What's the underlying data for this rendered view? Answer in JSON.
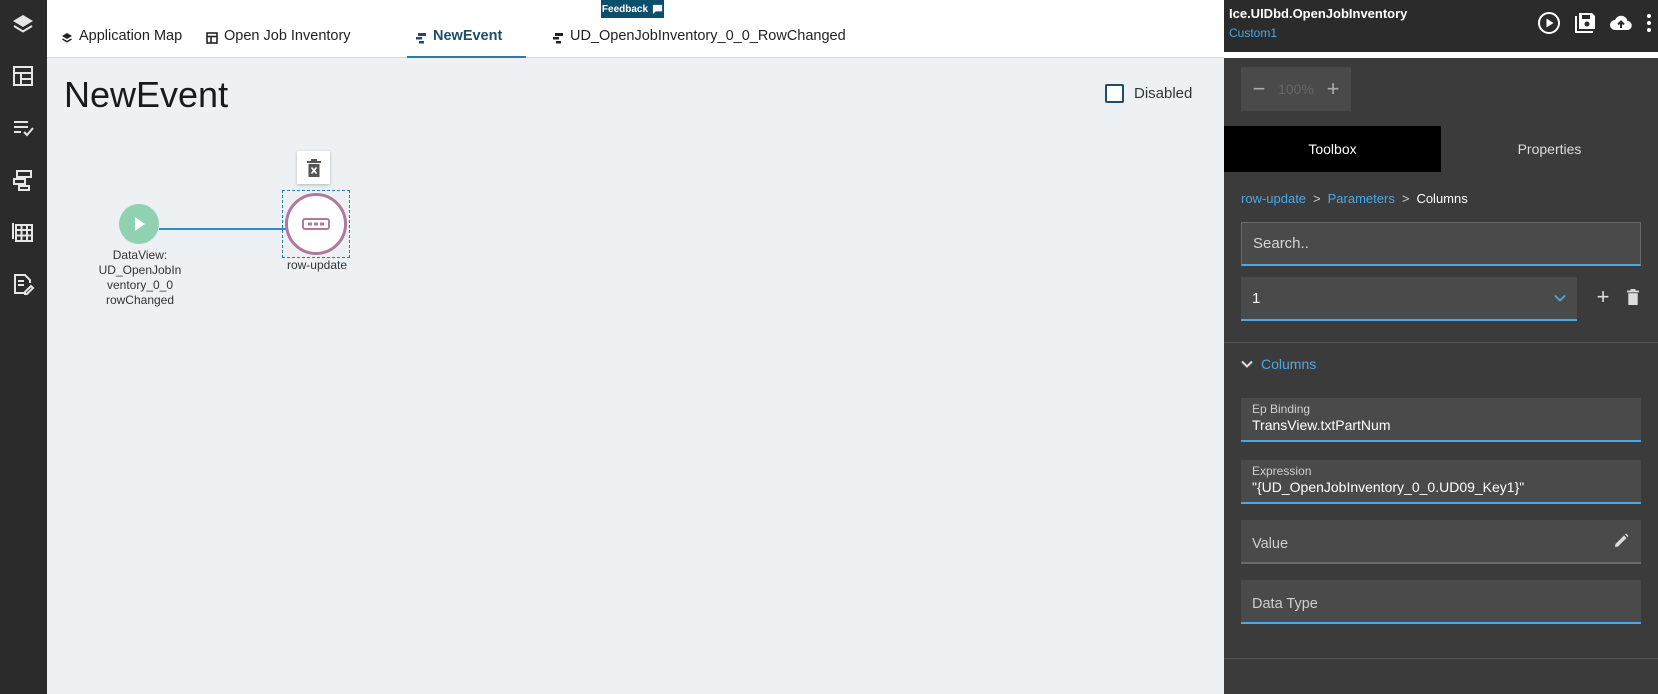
{
  "nav_rail": {
    "icons": [
      "layers-icon",
      "layout-icon",
      "list-check-icon",
      "events-icon",
      "grid-icon",
      "document-edit-icon"
    ]
  },
  "tabs": [
    {
      "label": "Application Map",
      "icon": "layers-icon"
    },
    {
      "label": "Open Job Inventory",
      "icon": "layout-icon"
    },
    {
      "label": "NewEvent",
      "icon": "event-icon",
      "active": true
    },
    {
      "label": "UD_OpenJobInventory_0_0_RowChanged",
      "icon": "event-icon"
    }
  ],
  "feedback": {
    "label": "Feedback"
  },
  "canvas": {
    "title": "NewEvent",
    "disabled_label": "Disabled",
    "disabled_checked": false,
    "start_node": {
      "label_lines": [
        "DataView:",
        "UD_OpenJobIn",
        "ventory_0_0",
        "rowChanged"
      ],
      "color": "#8fd1b0"
    },
    "action_node": {
      "label": "row-update",
      "color": "#b1799c"
    }
  },
  "right_panel": {
    "title": "Ice.UIDbd.OpenJobInventory",
    "subtitle": "Custom1",
    "header_actions": [
      "play-icon",
      "save-icon",
      "upload-icon",
      "more-icon"
    ],
    "zoom": {
      "minus": "−",
      "value": "100%",
      "plus": "+"
    },
    "tabs": [
      {
        "label": "Toolbox",
        "active": true
      },
      {
        "label": "Properties"
      }
    ],
    "breadcrumb": {
      "item1": "row-update",
      "item2": "Parameters",
      "current": "Columns",
      "sep": ">"
    },
    "search_placeholder": "Search..",
    "select_value": "1",
    "add_label": "+",
    "section_label": "Columns",
    "fields": {
      "ep_binding": {
        "label": "Ep Binding",
        "value": "TransView.txtPartNum"
      },
      "expression": {
        "label": "Expression",
        "value": "\"{UD_OpenJobInventory_0_0.UD09_Key1}\""
      },
      "value": {
        "placeholder": "Value"
      },
      "data_type": {
        "placeholder": "Data Type"
      }
    },
    "accent_color": "#4ba8e6"
  }
}
